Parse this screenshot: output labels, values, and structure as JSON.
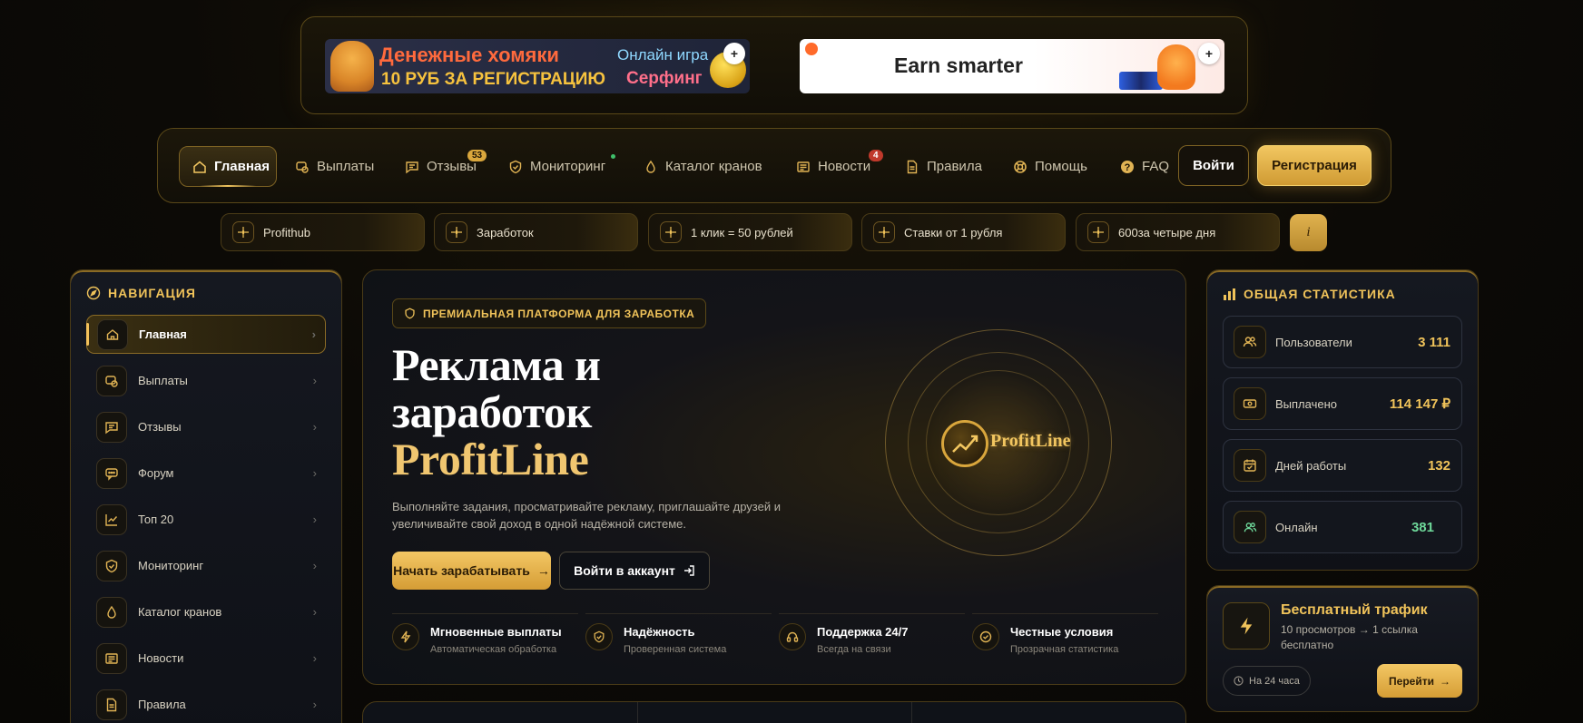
{
  "banners": {
    "b1_title": "Денежные хомяки",
    "b1_sub": "10 РУБ ЗА РЕГИСТРАЦИЮ",
    "b1_right1": "Онлайн игра",
    "b1_right2": "Серфинг",
    "b2_text": "Earn smarter",
    "plus": "+"
  },
  "nav": {
    "items": [
      {
        "label": "Главная",
        "icon": "home-icon"
      },
      {
        "label": "Выплаты",
        "icon": "payout-icon"
      },
      {
        "label": "Отзывы",
        "icon": "chat-icon",
        "badge": "53"
      },
      {
        "label": "Мониторинг",
        "icon": "shield-icon"
      },
      {
        "label": "Каталог кранов",
        "icon": "drop-icon"
      },
      {
        "label": "Новости",
        "icon": "news-icon",
        "badge": "4"
      },
      {
        "label": "Правила",
        "icon": "document-icon"
      },
      {
        "label": "Помощь",
        "icon": "lifebuoy-icon"
      },
      {
        "label": "FAQ",
        "icon": "question-icon"
      }
    ],
    "login": "Войти",
    "register": "Регистрация"
  },
  "ticker": {
    "items": [
      "Profithub",
      "Заработок",
      "1 клик = 50 рублей",
      "Ставки от 1 рубля",
      "600за четыре дня"
    ],
    "info": "i"
  },
  "sidebar": {
    "title": "НАВИГАЦИЯ",
    "items": [
      "Главная",
      "Выплаты",
      "Отзывы",
      "Форум",
      "Топ 20",
      "Мониторинг",
      "Каталог кранов",
      "Новости",
      "Правила"
    ]
  },
  "hero": {
    "tag": "ПРЕМИАЛЬНАЯ ПЛАТФОРМА ДЛЯ ЗАРАБОТКА",
    "title_line1": "Реклама и",
    "title_line2": "заработок",
    "title_brand": "ProfitLine",
    "desc": "Выполняйте задания, просматривайте рекламу, приглашайте друзей и увеличивайте свой доход в одной надёжной системе.",
    "btn_start": "Начать зарабатывать",
    "btn_account": "Войти в аккаунт",
    "logo_text": "ProfitLine",
    "features": [
      {
        "title": "Мгновенные выплаты",
        "sub": "Автоматическая обработка"
      },
      {
        "title": "Надёжность",
        "sub": "Проверенная система"
      },
      {
        "title": "Поддержка 24/7",
        "sub": "Всегда на связи"
      },
      {
        "title": "Честные условия",
        "sub": "Прозрачная статистика"
      }
    ]
  },
  "stats": {
    "title": "ОБЩАЯ СТАТИСТИКА",
    "items": [
      {
        "label": "Пользователи",
        "value": "3 111"
      },
      {
        "label": "Выплачено",
        "value": "114 147 ₽"
      },
      {
        "label": "Дней работы",
        "value": "132"
      },
      {
        "label": "Онлайн",
        "value": "381"
      }
    ]
  },
  "traffic": {
    "title": "Бесплатный трафик",
    "desc": "10 просмотров → 1 ссылка бесплатно",
    "pill": "На 24 часа",
    "btn": "Перейти"
  }
}
